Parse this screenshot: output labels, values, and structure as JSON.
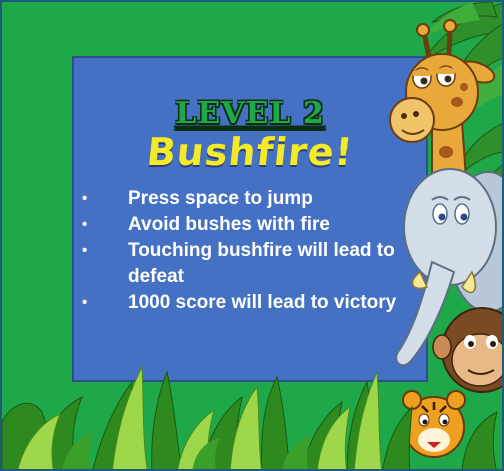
{
  "level_title": "LEVEL 2",
  "level_name": "Bushfire!",
  "rules": [
    "Press space to jump",
    "Avoid bushes with fire",
    "Touching bushfire will lead to defeat",
    "1000 score will lead to victory"
  ],
  "colors": {
    "background_green": "#1fa84a",
    "panel_blue": "#4571c4",
    "title_green": "#1fa84a",
    "name_yellow": "#f4ea2a",
    "text_white": "#ffffff"
  },
  "decorations": [
    "giraffe-icon",
    "elephant-icon",
    "monkey-icon",
    "tiger-icon",
    "jungle-grass",
    "palm-leaves"
  ]
}
